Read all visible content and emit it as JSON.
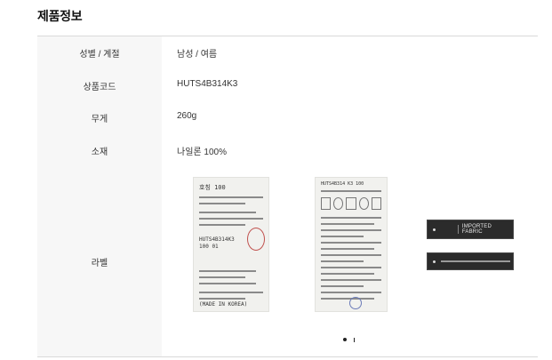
{
  "section": {
    "title": "제품정보"
  },
  "rows": [
    {
      "label": "성별 / 계절",
      "value": "남성 / 여름"
    },
    {
      "label": "상품코드",
      "value": "HUTS4B314K3"
    },
    {
      "label": "무게",
      "value": "260g"
    },
    {
      "label": "소재",
      "value": "나일론 100%"
    },
    {
      "label": "라벨",
      "value": ""
    }
  ],
  "label_images": {
    "care_label": {
      "size_line": "호칭 100",
      "code_line": "HUTS4B314K3 100 01",
      "origin_line": "(MADE IN KOREA)"
    },
    "wash_label": {
      "code_line": "HUTS4B314 K3 100"
    },
    "brand_tags": {
      "imported_fabric": "IMPORTED FABRIC"
    }
  },
  "carousel": {
    "current_page": 1,
    "total_pages": 2
  }
}
